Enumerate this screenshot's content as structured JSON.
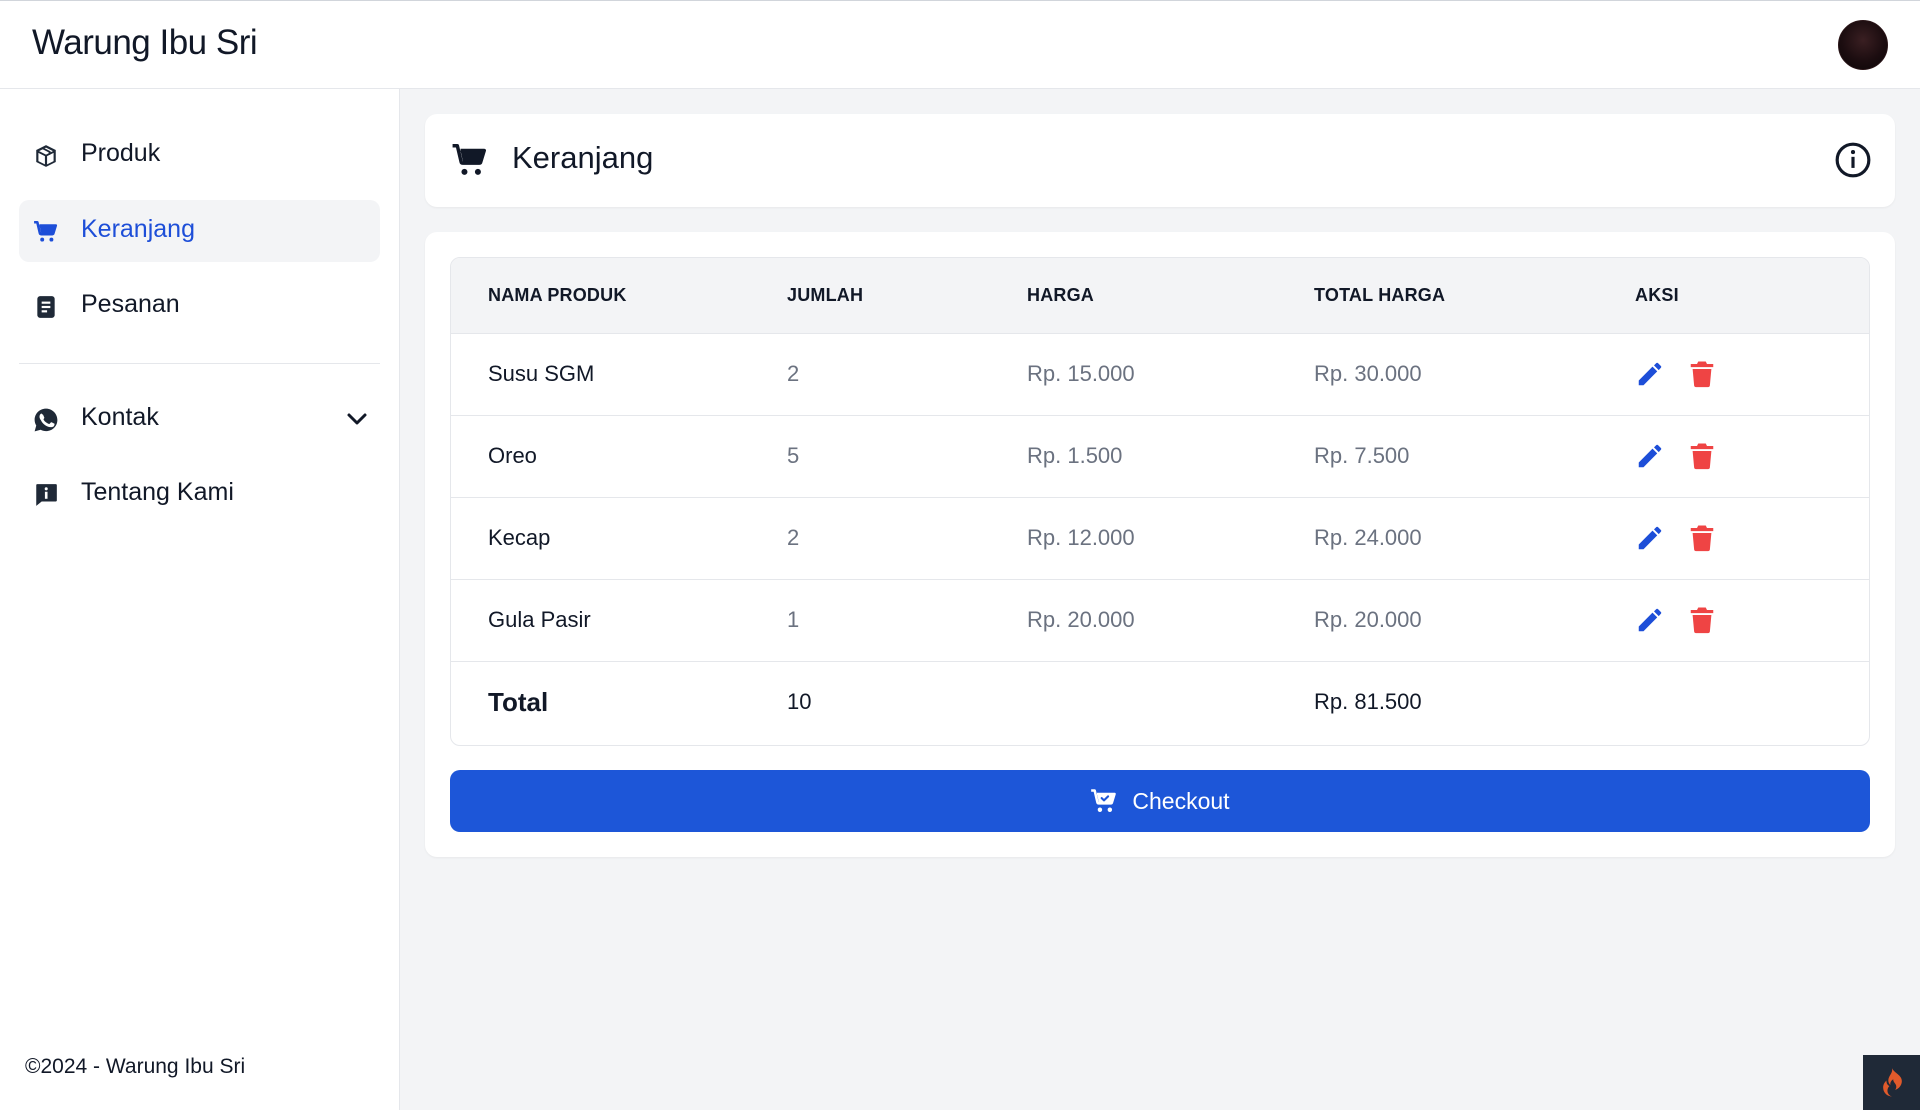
{
  "app": {
    "brand": "Warung Ibu Sri"
  },
  "sidebar": {
    "items": [
      {
        "label": "Produk",
        "icon": "box-icon"
      },
      {
        "label": "Keranjang",
        "icon": "cart-icon",
        "active": true
      },
      {
        "label": "Pesanan",
        "icon": "document-icon"
      },
      {
        "label": "Kontak",
        "icon": "whatsapp-icon",
        "expandable": true
      },
      {
        "label": "Tentang Kami",
        "icon": "info-message-icon"
      }
    ],
    "footer": "©2024 - Warung Ibu Sri"
  },
  "page": {
    "title": "Keranjang"
  },
  "table": {
    "headers": [
      "NAMA PRODUK",
      "JUMLAH",
      "HARGA",
      "TOTAL HARGA",
      "AKSI"
    ],
    "rows": [
      {
        "name": "Susu SGM",
        "qty": "2",
        "price": "Rp. 15.000",
        "total": "Rp. 30.000"
      },
      {
        "name": "Oreo",
        "qty": "5",
        "price": "Rp. 1.500",
        "total": "Rp. 7.500"
      },
      {
        "name": "Kecap",
        "qty": "2",
        "price": "Rp. 12.000",
        "total": "Rp. 24.000"
      },
      {
        "name": "Gula Pasir",
        "qty": "1",
        "price": "Rp. 20.000",
        "total": "Rp. 20.000"
      }
    ],
    "total": {
      "label": "Total",
      "qty": "10",
      "amount": "Rp. 81.500"
    }
  },
  "checkout": {
    "label": "Checkout"
  },
  "colors": {
    "accent": "#1d56d8",
    "danger": "#ef4444",
    "text": "#111827",
    "muted": "#6b7280"
  }
}
